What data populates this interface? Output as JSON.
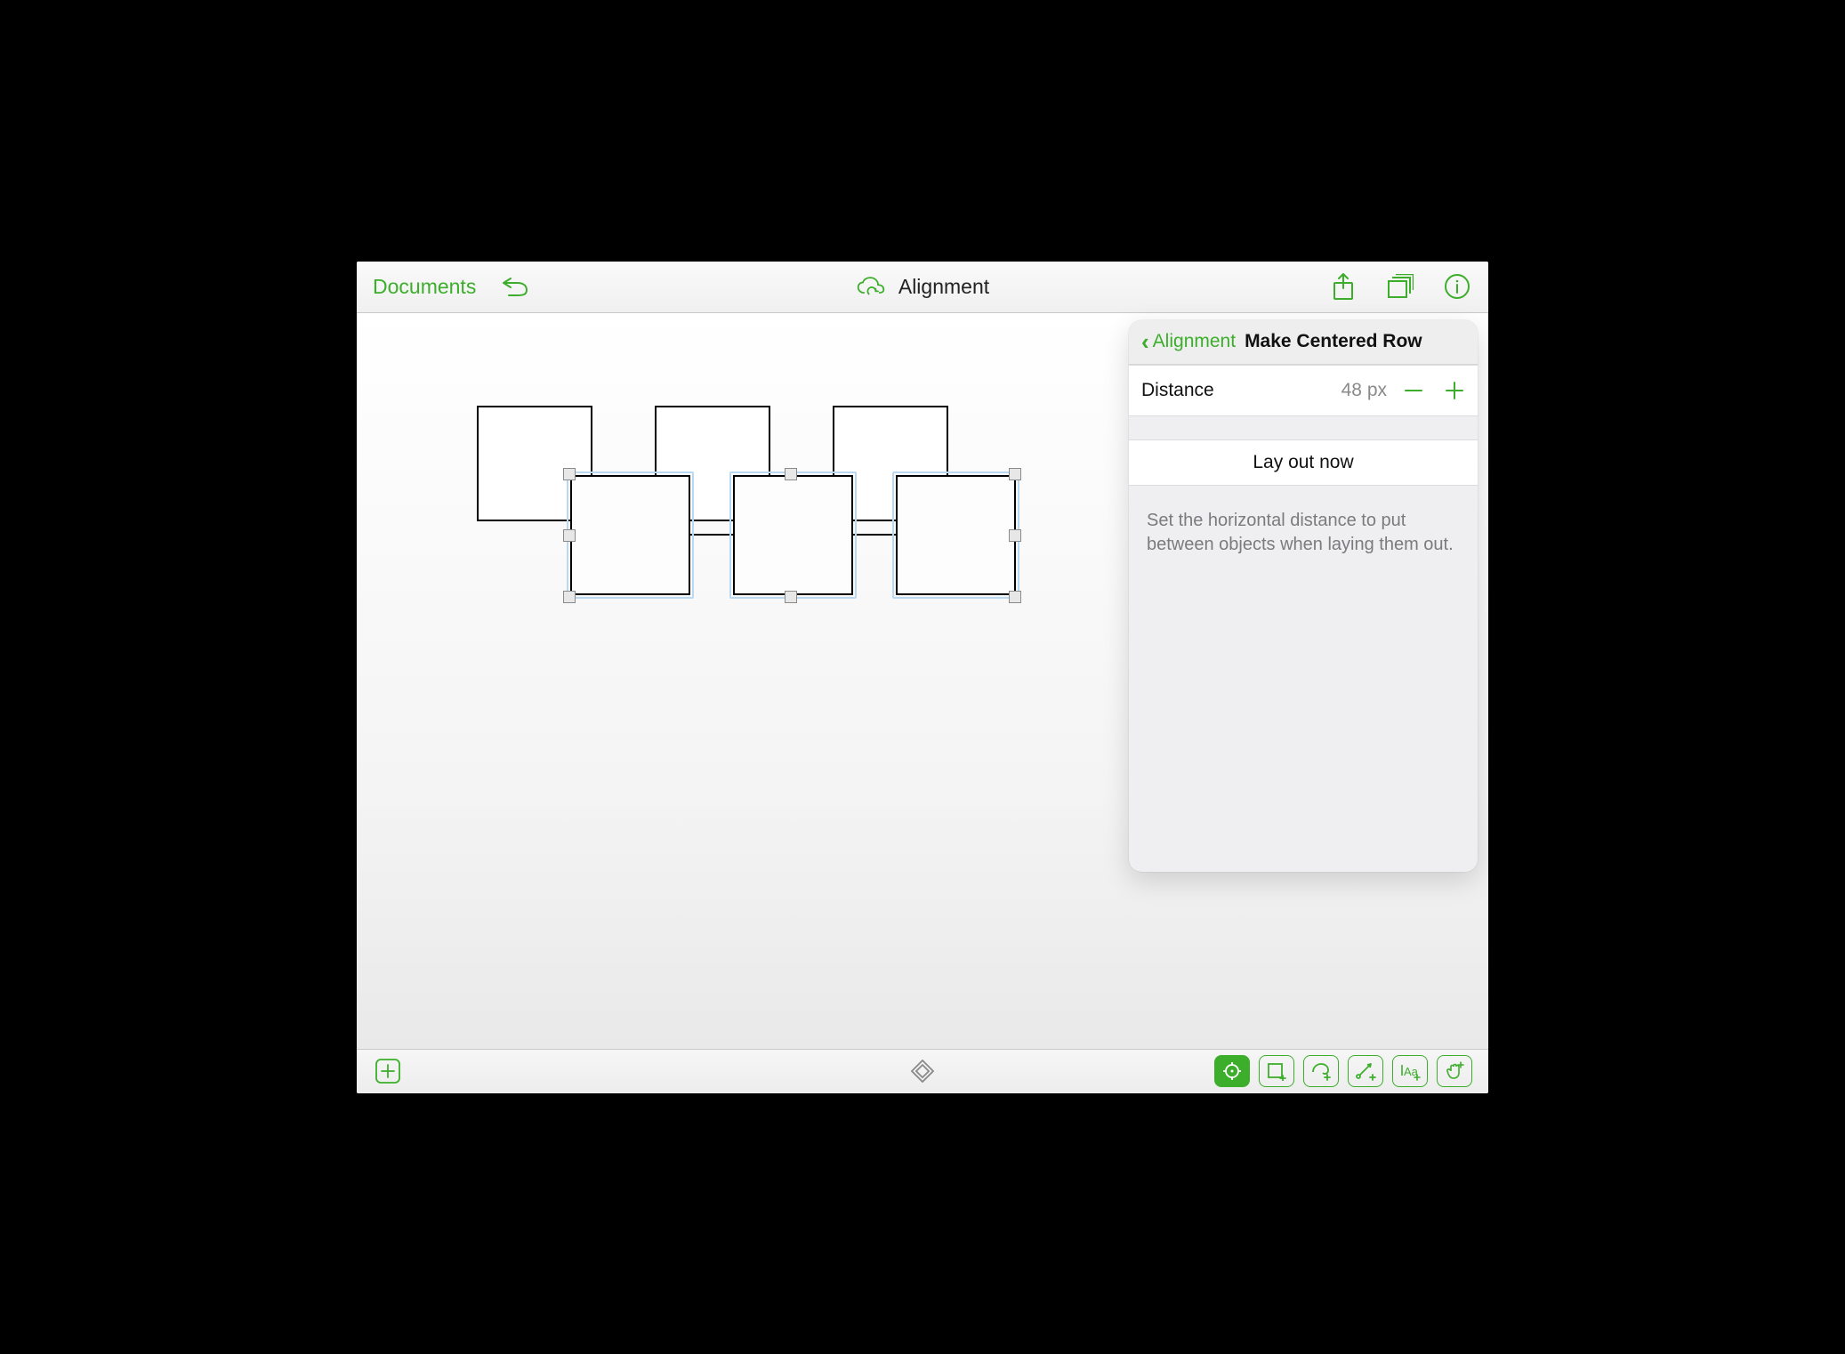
{
  "toolbar": {
    "documents_label": "Documents",
    "title": "Alignment"
  },
  "panel": {
    "back_label": "Alignment",
    "title": "Make Centered Row",
    "distance_label": "Distance",
    "distance_value": "48 px",
    "action_label": "Lay out now",
    "hint": "Set the horizontal distance to put between objects when laying them out."
  }
}
